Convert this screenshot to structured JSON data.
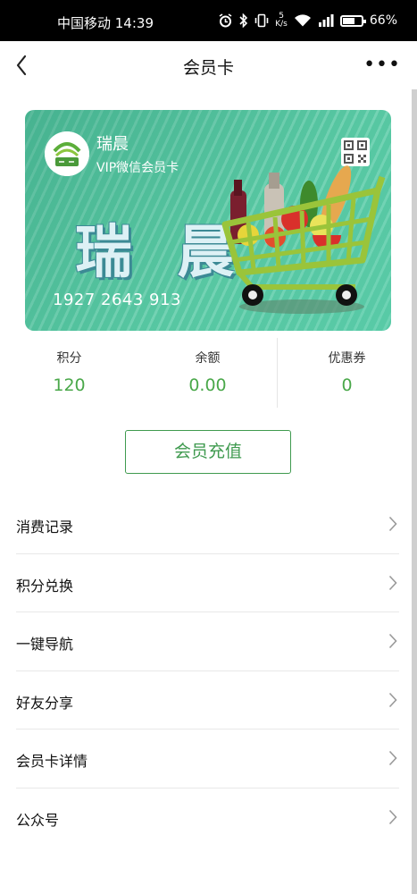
{
  "status_bar": {
    "carrier_time": "中国移动 14:39",
    "speed_top": "5",
    "speed_unit": "K/s",
    "battery": "66%",
    "icons": [
      "alarm-icon",
      "bluetooth-icon",
      "vibrate-icon",
      "speed-indicator",
      "wifi-icon",
      "signal-icon",
      "battery-icon"
    ]
  },
  "nav": {
    "title": "会员卡",
    "back_icon": "chevron-left-icon",
    "more_label": "•••"
  },
  "card": {
    "brand": "瑞晨",
    "subtitle": "VIP微信会员卡",
    "big_name": "瑞 晨",
    "number": "1927 2643 913",
    "colors": {
      "stripe_dark": "#57c7a2",
      "stripe_light": "#74d3b4",
      "cart": "#9ac43a"
    }
  },
  "stats": [
    {
      "label": "积分",
      "value": "120"
    },
    {
      "label": "余额",
      "value": "0.00"
    },
    {
      "label": "优惠券",
      "value": "0"
    }
  ],
  "recharge_button": "会员充值",
  "menu": [
    {
      "label": "消费记录"
    },
    {
      "label": "积分兑换"
    },
    {
      "label": "一键导航"
    },
    {
      "label": "好友分享"
    },
    {
      "label": "会员卡详情"
    },
    {
      "label": "公众号"
    }
  ],
  "accent_color": "#4aa84a"
}
